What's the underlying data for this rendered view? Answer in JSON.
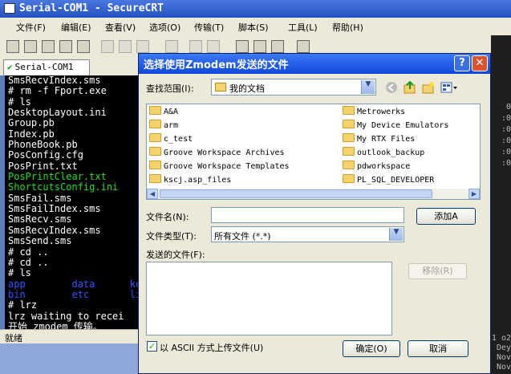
{
  "app": {
    "title": "Serial-COM1 - SecureCRT",
    "menu": [
      "文件(F)",
      "编辑(E)",
      "查看(V)",
      "选项(O)",
      "传输(T)",
      "脚本(S)",
      "工具(L)",
      "帮助(H)"
    ],
    "tab_label": "Serial-COM1",
    "status": "就绪"
  },
  "terminal": {
    "lines": [
      {
        "text": "SmsRecvIndex.sms",
        "color": "#ffffff"
      },
      {
        "text": "# rm -f Fport.exe",
        "color": "#ffffff"
      },
      {
        "text": "# ls",
        "color": "#ffffff"
      },
      {
        "text": "DesktopLayout.ini",
        "color": "#ffffff"
      },
      {
        "text": "Group.pb",
        "color": "#ffffff"
      },
      {
        "text": "Index.pb",
        "color": "#ffffff"
      },
      {
        "text": "PhoneBook.pb",
        "color": "#ffffff"
      },
      {
        "text": "PosConfig.cfg",
        "color": "#ffffff"
      },
      {
        "text": "PosPrint.txt",
        "color": "#ffffff"
      },
      {
        "text": "PosPrintClear.txt",
        "color": "#22dd22"
      },
      {
        "text": "ShortcutsConfig.ini",
        "color": "#22dd22"
      },
      {
        "text": "SmsFail.sms",
        "color": "#ffffff"
      },
      {
        "text": "SmsFailIndex.sms",
        "color": "#ffffff"
      },
      {
        "text": "SmsRecv.sms",
        "color": "#ffffff"
      },
      {
        "text": "SmsRecvIndex.sms",
        "color": "#ffffff"
      },
      {
        "text": "SmsSend.sms",
        "color": "#ffffff"
      },
      {
        "text": "# cd ..",
        "color": "#ffffff"
      },
      {
        "text": "# cd ..",
        "color": "#ffffff"
      },
      {
        "text": "# ls",
        "color": "#ffffff"
      },
      {
        "text": "app        data      ke",
        "color": "#3355ff"
      },
      {
        "text": "bin        etc       li",
        "color": "#3355ff"
      },
      {
        "text": "# lrz",
        "color": "#ffffff"
      },
      {
        "text": "lrz waiting to recei",
        "color": "#ffffff"
      },
      {
        "text": "开始 zmodem 传输。",
        "color": "#ffffff"
      }
    ]
  },
  "edge_text": [
    "0",
    ":0",
    ":0",
    ":0",
    ":0",
    ":0",
    "1 o2",
    "Dey",
    "Nov",
    "Nov"
  ],
  "dialog": {
    "title": "选择使用Zmodem发送的文件",
    "help": "?",
    "close": "✕",
    "lookin_label": "查找范围(I):",
    "lookin_value": "我的文档",
    "files_left": [
      "A&A",
      "arm",
      "c_test",
      "Groove Workspace Archives",
      "Groove Workspace Templates",
      "kscj.asp_files"
    ],
    "files_right": [
      "Metrowerks",
      "My Device Emulators",
      "My RTX Files",
      "outlook_backup",
      "pdworkspace",
      "PL_SQL_DEVELOPER"
    ],
    "filename_label": "文件名(N):",
    "filename_value": "",
    "add_button": "添加A",
    "filetype_label": "文件类型(T):",
    "filetype_value": "所有文件 (*.*)",
    "sent_label": "发送的文件(F):",
    "remove_button": "移除(R)",
    "ascii_label": "以 ASCII 方式上传文件(U)",
    "ascii_checked": "✓",
    "ok_button": "确定(O)",
    "cancel_button": "取消"
  }
}
